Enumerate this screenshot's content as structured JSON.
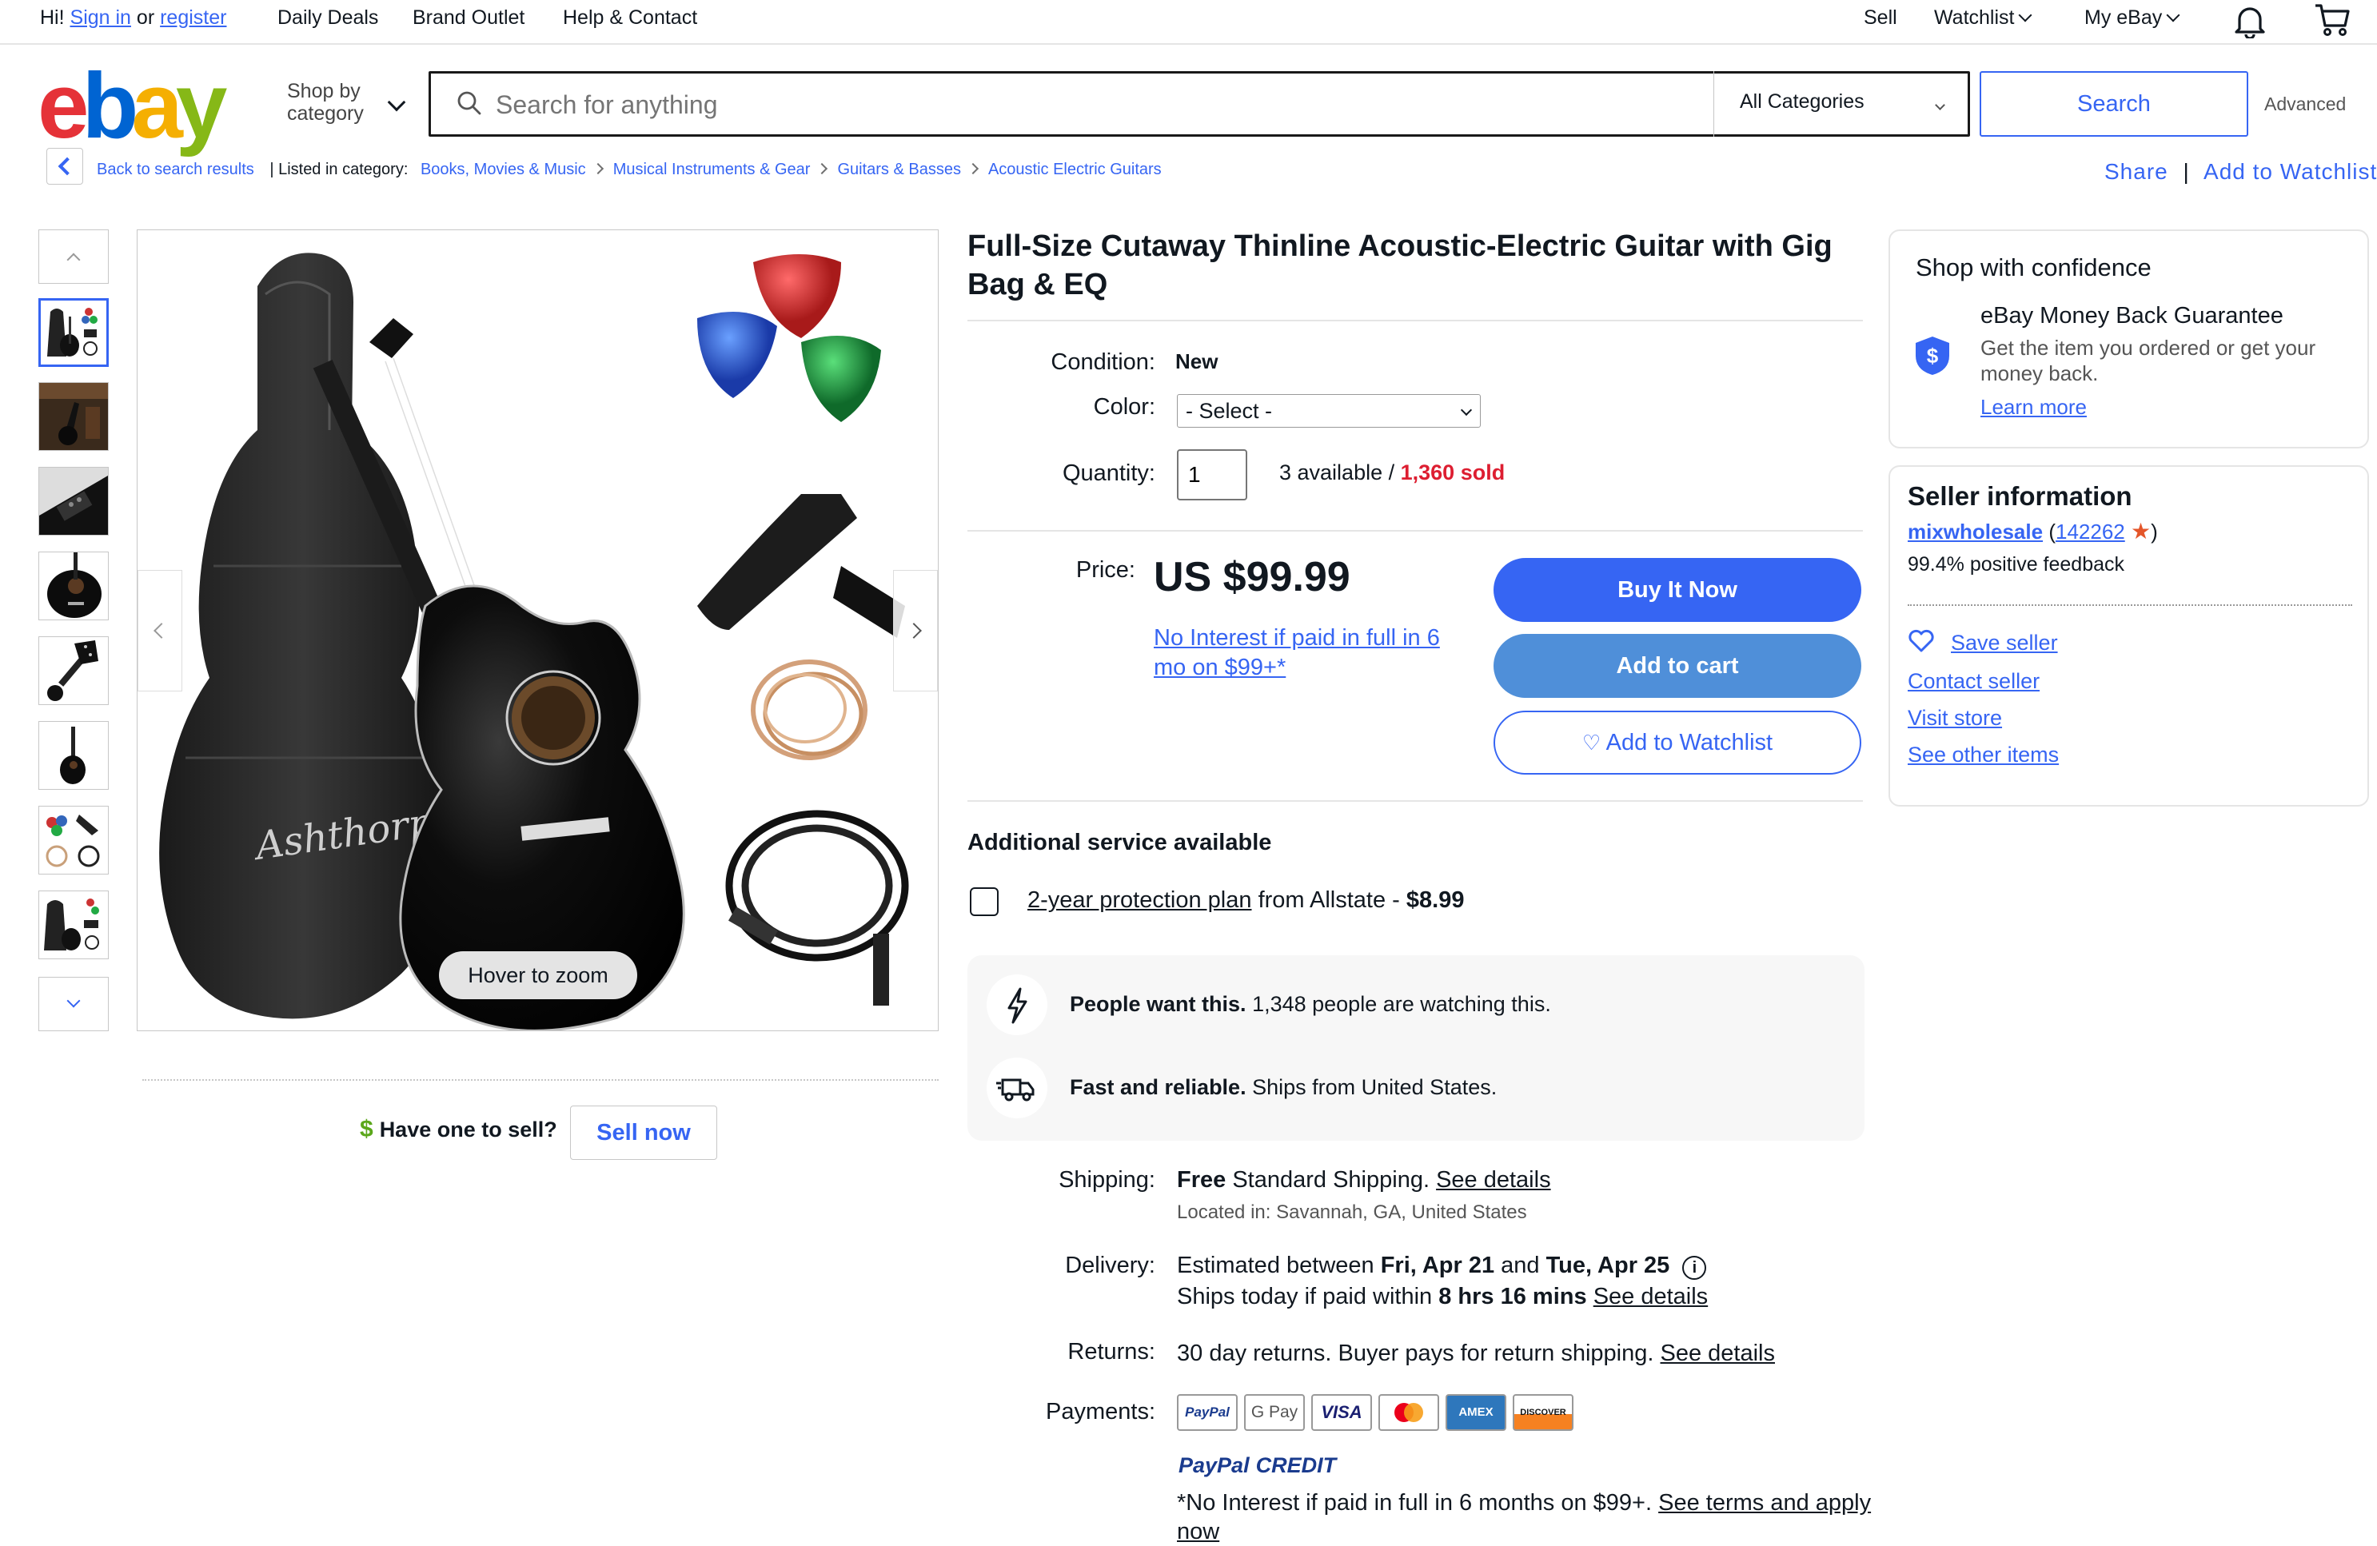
{
  "topbar": {
    "greeting": "Hi!",
    "sign_in": "Sign in",
    "or": "or",
    "register": "register",
    "daily_deals": "Daily Deals",
    "brand_outlet": "Brand Outlet",
    "help_contact": "Help & Contact",
    "sell": "Sell",
    "watchlist": "Watchlist",
    "my_ebay": "My eBay"
  },
  "header": {
    "logo_letters": [
      "e",
      "b",
      "a",
      "y"
    ],
    "logo_colors": [
      "#e53238",
      "#0064d2",
      "#f5af02",
      "#86b817"
    ],
    "shop_by_category_line1": "Shop by",
    "shop_by_category_line2": "category",
    "search_placeholder": "Search for anything",
    "category_select": "All Categories",
    "search_button": "Search",
    "advanced": "Advanced"
  },
  "breadcrumb": {
    "back": "Back to search results",
    "listed_in": "| Listed in category:",
    "items": [
      "Books, Movies & Music",
      "Musical Instruments & Gear",
      "Guitars & Basses",
      "Acoustic Electric Guitars"
    ],
    "share": "Share",
    "add_to_watchlist": "Add to Watchlist"
  },
  "gallery": {
    "hover_to_zoom": "Hover to zoom",
    "have_one_to_sell": "Have one to sell?",
    "sell_now": "Sell now",
    "brand_script": "Ashthorpe"
  },
  "listing": {
    "title": "Full-Size Cutaway Thinline Acoustic-Electric Guitar with Gig Bag & EQ",
    "condition_label": "Condition:",
    "condition_value": "New",
    "color_label": "Color:",
    "color_select": "- Select -",
    "quantity_label": "Quantity:",
    "quantity_value": "1",
    "available": "3 available /",
    "sold": "1,360 sold",
    "price_label": "Price:",
    "price": "US $99.99",
    "financing": "No Interest if paid in full in 6 mo on $99+*",
    "buy_it_now": "Buy It Now",
    "add_to_cart": "Add to cart",
    "add_to_watchlist": "Add to Watchlist",
    "additional_service": "Additional service available",
    "protection_link": "2-year protection plan",
    "protection_rest": "from Allstate -",
    "protection_price": "$8.99",
    "signal1_bold": "People want this.",
    "signal1_text": "1,348 people are watching this.",
    "signal2_bold": "Fast and reliable.",
    "signal2_text": "Ships from United States.",
    "shipping_label": "Shipping:",
    "shipping_free": "Free",
    "shipping_text": "Standard Shipping.",
    "see_details": "See details",
    "located_in": "Located in: Savannah, GA, United States",
    "delivery_label": "Delivery:",
    "delivery_est": "Estimated between",
    "delivery_d1": "Fri, Apr 21",
    "delivery_and": "and",
    "delivery_d2": "Tue, Apr 25",
    "ships_today": "Ships today if paid within",
    "ships_time": "8 hrs 16 mins",
    "returns_label": "Returns:",
    "returns_text": "30 day returns. Buyer pays for return shipping.",
    "payments_label": "Payments:",
    "payment_icons": [
      "PayPal",
      "G Pay",
      "VISA",
      "Mastercard",
      "AMEX",
      "DISCOVER"
    ],
    "paypal_credit_1": "PayPal",
    "paypal_credit_2": "CREDIT",
    "paypal_note": "*No Interest if paid in full in 6 months on $99+.",
    "see_terms": "See terms and apply now"
  },
  "confidence": {
    "title": "Shop with confidence",
    "guarantee": "eBay Money Back Guarantee",
    "guarantee_text": "Get the item you ordered or get your money back.",
    "learn_more": "Learn more"
  },
  "seller": {
    "title": "Seller information",
    "name": "mixwholesale",
    "feedback_count": "142262",
    "positive": "99.4% positive feedback",
    "save_seller": "Save seller",
    "contact_seller": "Contact seller",
    "visit_store": "Visit store",
    "see_other_items": "See other items"
  }
}
